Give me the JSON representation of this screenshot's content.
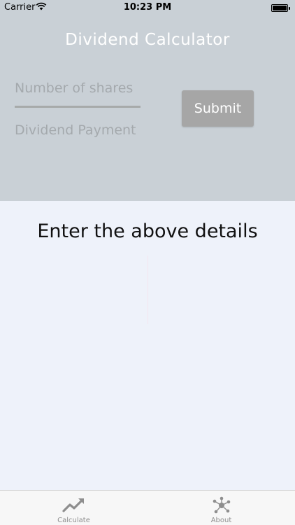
{
  "status_bar": {
    "carrier": "Carrier",
    "time": "10:23 PM"
  },
  "app": {
    "title": "Dividend Calculator"
  },
  "form": {
    "shares_placeholder": "Number of shares",
    "shares_value": "",
    "dividend_placeholder": "Dividend Payment",
    "dividend_value": "",
    "submit_label": "Submit"
  },
  "result": {
    "message": "Enter the above details"
  },
  "tabs": [
    {
      "label": "Calculate",
      "icon": "trending-up-icon"
    },
    {
      "label": "About",
      "icon": "network-icon"
    }
  ],
  "colors": {
    "header_bg": "#c9d0d6",
    "body_bg": "#eef2fa",
    "submit_bg": "#a6a6a6",
    "tab_icon": "#8e8e8e"
  }
}
